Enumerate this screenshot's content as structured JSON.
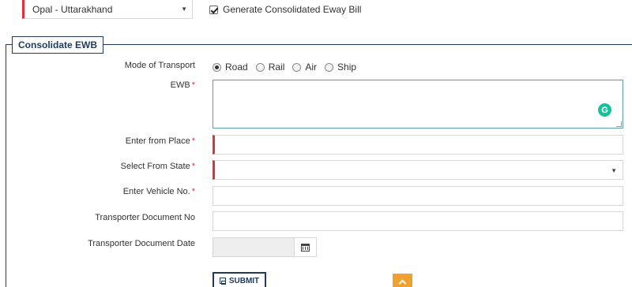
{
  "top": {
    "location_select_value": "Opal - Uttarakhand",
    "consolidated_label": "Generate Consolidated Eway Bill",
    "consolidated_checked": true
  },
  "section": {
    "title": "Consolidate EWB"
  },
  "form": {
    "mode_label": "Mode of Transport",
    "modes": [
      {
        "label": "Road",
        "checked": true
      },
      {
        "label": "Rail",
        "checked": false
      },
      {
        "label": "Air",
        "checked": false
      },
      {
        "label": "Ship",
        "checked": false
      }
    ],
    "ewb_label": "EWB",
    "from_place_label": "Enter from Place",
    "from_state_label": "Select From State",
    "vehicle_label": "Enter Vehicle No.",
    "transporter_doc_no_label": "Transporter Document No",
    "transporter_doc_date_label": "Transporter Document Date",
    "required_mark": "*",
    "grammarly_icon_letter": "G"
  },
  "actions": {
    "submit_label": "SUBMIT"
  },
  "colors": {
    "required": "#e0323b",
    "primary": "#1d3a5e",
    "accent": "#f0a030",
    "grammarly": "#15c39a"
  }
}
